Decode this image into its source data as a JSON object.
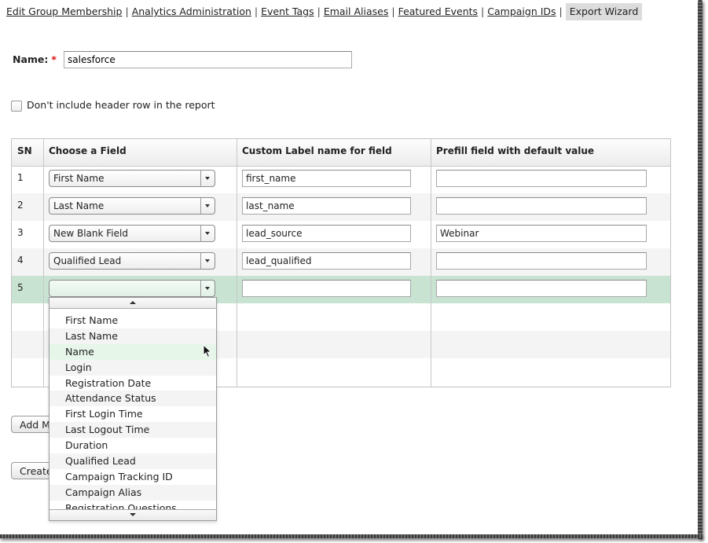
{
  "nav": {
    "links": [
      {
        "label": "Edit Group Membership"
      },
      {
        "label": "Analytics Administration"
      },
      {
        "label": "Event Tags"
      },
      {
        "label": "Email Aliases"
      },
      {
        "label": "Featured Events"
      },
      {
        "label": "Campaign IDs"
      }
    ],
    "active": "Export Wizard",
    "separator": "|"
  },
  "form": {
    "name_label": "Name:",
    "required_mark": "*",
    "name_value": "salesforce",
    "header_checkbox_label": "Don't include header row in the report",
    "header_checkbox_checked": false
  },
  "table": {
    "columns": [
      "SN",
      "Choose a Field",
      "Custom Label name for field",
      "Prefill field with default value"
    ],
    "rows": [
      {
        "sn": "1",
        "field": "First Name",
        "label": "first_name",
        "prefill": ""
      },
      {
        "sn": "2",
        "field": "Last Name",
        "label": "last_name",
        "prefill": ""
      },
      {
        "sn": "3",
        "field": "New Blank Field",
        "label": "lead_source",
        "prefill": "Webinar"
      },
      {
        "sn": "4",
        "field": "Qualified Lead",
        "label": "lead_qualified",
        "prefill": ""
      },
      {
        "sn": "5",
        "field": "",
        "label": "",
        "prefill": "",
        "selected": true
      }
    ],
    "selected_row_color": "#c9e3d2"
  },
  "dropdown": {
    "open": true,
    "hovered": "Name",
    "options": [
      "First Name",
      "Last Name",
      "Name",
      "Login",
      "Registration Date",
      "Attendance Status",
      "First Login Time",
      "Last Logout Time",
      "Duration",
      "Qualified Lead",
      "Campaign Tracking ID",
      "Campaign Alias",
      "Registration Questions"
    ]
  },
  "buttons": {
    "add_more_label": "Add More",
    "create_label": "Create"
  }
}
